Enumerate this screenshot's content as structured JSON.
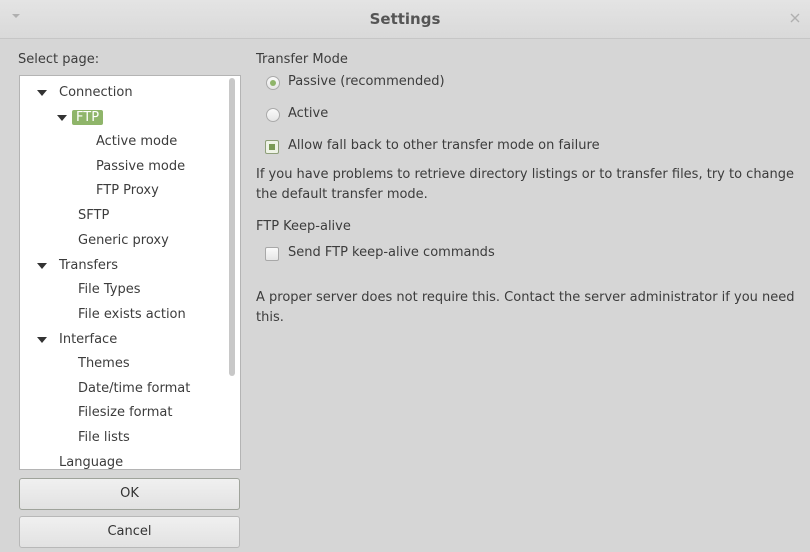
{
  "window": {
    "title": "Settings"
  },
  "left": {
    "select_page_label": "Select page:",
    "tree": [
      {
        "label": "Connection"
      },
      {
        "label": "FTP"
      },
      {
        "label": "Active mode"
      },
      {
        "label": "Passive mode"
      },
      {
        "label": "FTP Proxy"
      },
      {
        "label": "SFTP"
      },
      {
        "label": "Generic proxy"
      },
      {
        "label": "Transfers"
      },
      {
        "label": "File Types"
      },
      {
        "label": "File exists action"
      },
      {
        "label": "Interface"
      },
      {
        "label": "Themes"
      },
      {
        "label": "Date/time format"
      },
      {
        "label": "Filesize format"
      },
      {
        "label": "File lists"
      },
      {
        "label": "Language"
      }
    ],
    "ok_label": "OK",
    "cancel_label": "Cancel"
  },
  "transfer_mode": {
    "heading": "Transfer Mode",
    "passive_label": "Passive (recommended)",
    "passive_selected": true,
    "active_label": "Active",
    "fallback_label": "Allow fall back to other transfer mode on failure",
    "fallback_checked": true,
    "note": "If you have problems to retrieve directory listings or to transfer files, try to change the default transfer mode."
  },
  "keepalive": {
    "heading": "FTP Keep-alive",
    "checkbox_label": "Send FTP keep-alive commands",
    "checked": false,
    "note": "A proper server does not require this. Contact the server administrator if you need this."
  },
  "colors": {
    "accent": "#8fb56a"
  }
}
